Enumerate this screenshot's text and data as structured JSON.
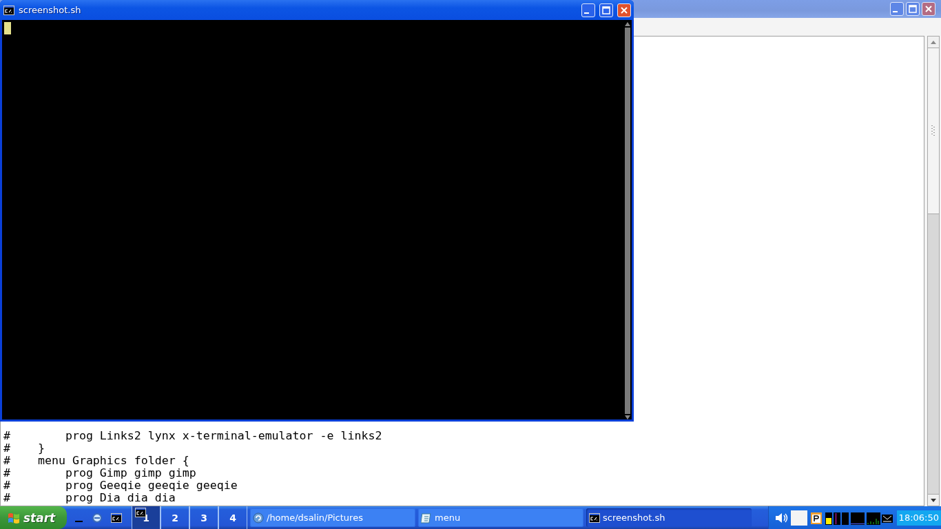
{
  "editor_window": {
    "lines": [
      "#        prog Links2 lynx x-terminal-emulator -e links2",
      "#    }",
      "#    menu Graphics folder {",
      "#        prog Gimp gimp gimp",
      "#        prog Geeqie geeqie geeqie",
      "#        prog Dia dia dia"
    ]
  },
  "terminal_window": {
    "title": "screenshot.sh"
  },
  "taskbar": {
    "start_label": "start",
    "workspaces": [
      {
        "label": "1",
        "selected": true
      },
      {
        "label": "2",
        "selected": false
      },
      {
        "label": "3",
        "selected": false
      },
      {
        "label": "4",
        "selected": false
      }
    ],
    "tasks": [
      {
        "label": "/home/dsalin/Pictures",
        "kind": "folder",
        "selected": false
      },
      {
        "label": "menu",
        "kind": "editor",
        "selected": false
      },
      {
        "label": "screenshot.sh",
        "kind": "terminal",
        "selected": true
      }
    ],
    "clock": "18:06:50"
  }
}
